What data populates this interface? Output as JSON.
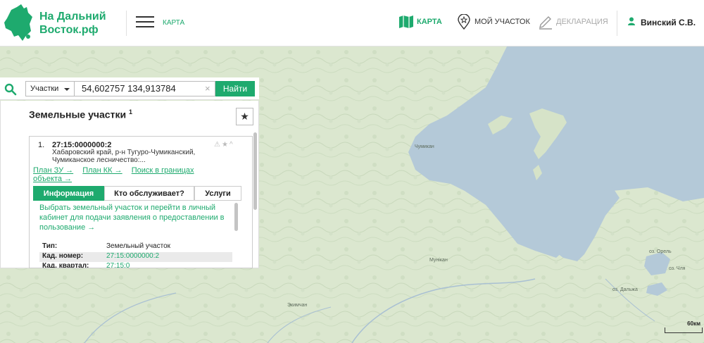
{
  "header": {
    "logo_line1": "На Дальний",
    "logo_line2": "Восток.рф",
    "menu_label": "КАРТА",
    "nav": [
      {
        "label": "КАРТА",
        "icon": "map-icon",
        "active": true
      },
      {
        "label": "МОЙ УЧАСТОК",
        "icon": "map-pin-icon",
        "active": false
      },
      {
        "label": "ДЕКЛАРАЦИЯ",
        "icon": "pencil-icon",
        "active": false
      }
    ],
    "user_name": "Винский С.В."
  },
  "search": {
    "type_label": "Участки",
    "query": "54,602757 134,913784",
    "clear": "×",
    "button": "Найти"
  },
  "panel": {
    "title": "Земельные участки",
    "count": "1",
    "result": {
      "index": "1.",
      "cadastral": "27:15:0000000:2",
      "address": "Хабаровский край, р-н Тугуро-Чумиканский, Чумиканское лесничество:...",
      "links": [
        "План ЗУ →",
        "План КК →",
        "Поиск в границах объекта →"
      ],
      "tabs": [
        "Информация",
        "Кто обслуживает?",
        "Услуги"
      ],
      "action_text": "Выбрать земельный участок и перейти в личный кабинет для подачи заявления о предоставлении в пользование →",
      "rows": [
        {
          "key": "Тип:",
          "value": "Земельный участок"
        },
        {
          "key": "Кад. номер:",
          "value": "27:15:0000000:2"
        },
        {
          "key": "Кад. квартал:",
          "value": "27:15:0"
        }
      ]
    }
  },
  "map": {
    "labels": [
      "Чумикан",
      "оз. Орель",
      "оз. Чля",
      "оз. Дальжа",
      "Экимчан",
      "Мунікан"
    ],
    "scale": "60км"
  },
  "colors": {
    "brand": "#1eaa6e",
    "water": "#b4c9d8",
    "land": "#dbe7cf"
  }
}
